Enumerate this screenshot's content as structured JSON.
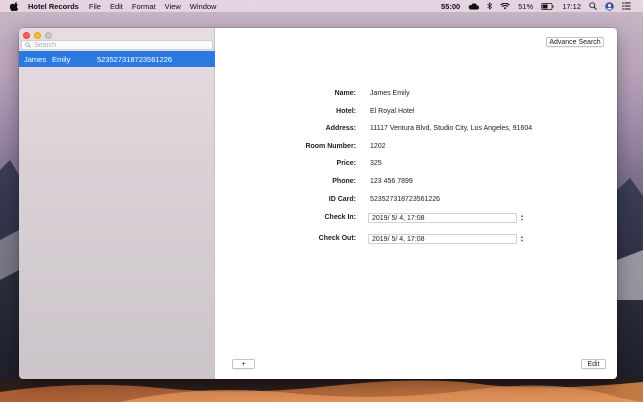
{
  "menubar": {
    "app_name": "Hotel Records",
    "menus": [
      "File",
      "Edit",
      "Format",
      "View",
      "Window"
    ],
    "timer": "55:00",
    "battery": "51%",
    "clock": "17:12"
  },
  "sidebar": {
    "search_placeholder": "Search",
    "records": [
      {
        "first_name": "James",
        "last_name": "Emily",
        "id_card": "523527318723561226",
        "selected": true
      }
    ]
  },
  "toolbar": {
    "advance_search_label": "Advance Search",
    "add_label": "+",
    "edit_label": "Edit"
  },
  "detail": {
    "labels": {
      "name": "Name:",
      "hotel": "Hotel:",
      "address": "Address:",
      "room_number": "Room Number:",
      "price": "Price:",
      "phone": "Phone:",
      "id_card": "ID Card:",
      "check_in": "Check In:",
      "check_out": "Check Out:"
    },
    "values": {
      "name": "James    Emily",
      "hotel": "El Royal Hotel",
      "address": "11117 Ventura Blvd, Studio City, Los Angeles, 91604",
      "room_number": "1202",
      "price": "325",
      "phone": "123 456 7899",
      "id_card": "523527318723561226",
      "check_in": "2019/  5/  4, 17:08",
      "check_out": "2019/  5/  4, 17:08"
    }
  },
  "colors": {
    "selection": "#2a7ae2",
    "close": "#fc5f57",
    "minimize": "#fdbc2e"
  }
}
